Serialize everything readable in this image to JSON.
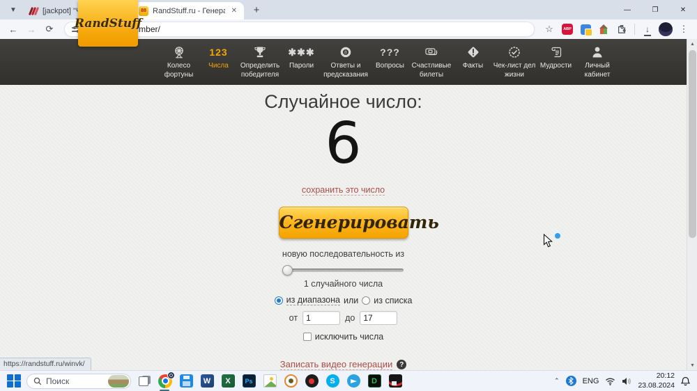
{
  "browser": {
    "tabs": [
      {
        "title": "[jackpot] \"Чертово колесо\" Wi"
      },
      {
        "title": "RandStuff.ru - Генератор случа",
        "favicon_text": "88"
      }
    ],
    "new_tab_glyph": "+",
    "close_glyph": "✕",
    "window_controls": {
      "minimize": "—",
      "restore": "❐",
      "close": "✕"
    },
    "toolbar": {
      "back": "←",
      "forward": "→",
      "reload": "⟳",
      "url": "randstuff.ru/number/",
      "star": "☆",
      "download": "↓",
      "menu": "⋮"
    },
    "status_url": "https://randstuff.ru/winvk/"
  },
  "nav": {
    "logo": "RandStuff",
    "items": [
      {
        "label": "Колесо фортуны"
      },
      {
        "label": "Числа",
        "glyph": "123"
      },
      {
        "label": "Определить победителя"
      },
      {
        "label": "Пароли",
        "glyph": "✱✱✱"
      },
      {
        "label": "Ответы и предсказания"
      },
      {
        "label": "Вопросы",
        "glyph": "???"
      },
      {
        "label": "Счастливые билеты"
      },
      {
        "label": "Факты"
      },
      {
        "label": "Чек-лист дел жизни"
      },
      {
        "label": "Мудрости"
      },
      {
        "label": "Личный кабинет"
      }
    ]
  },
  "main": {
    "heading": "Случайное число:",
    "number": "6",
    "save_link": "сохранить это число",
    "generate_button": "Сгенерировать",
    "sequence_label": "новую последовательность из",
    "count_label": "1 случайного числа",
    "range_option": "из диапазона",
    "or_label": "или",
    "list_option": "из списка",
    "from_label": "от",
    "from_value": "1",
    "to_label": "до",
    "to_value": "17",
    "exclude_label": "исключить числа",
    "video_link": "Записать видео генерации",
    "help_glyph": "?"
  },
  "taskbar": {
    "search_placeholder": "Поиск",
    "word_letter": "W",
    "excel_letter": "X",
    "ps_letters": "Ps",
    "skype_letter": "S",
    "d_letter": "D",
    "language": "ENG",
    "time": "20:12",
    "date": "23.08.2024"
  },
  "colors": {
    "accent_yellow": "#f5a800",
    "link_red": "#a94e48",
    "nav_dark": "#363532",
    "page_bg": "#f1f1ef"
  }
}
